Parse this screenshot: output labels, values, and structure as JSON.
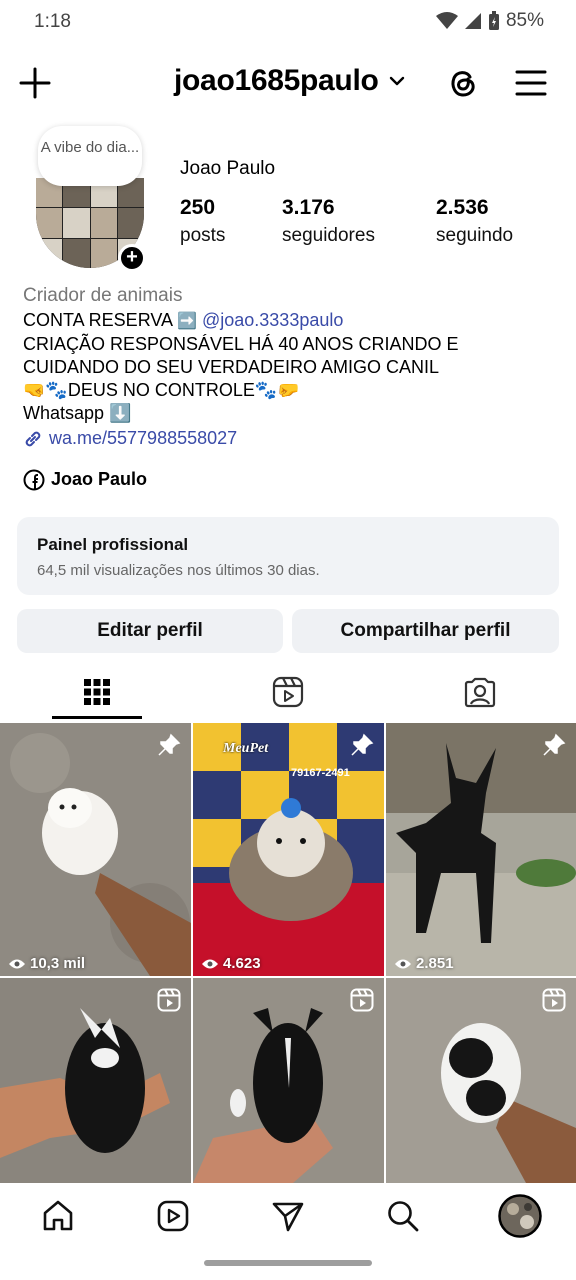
{
  "status_bar": {
    "time": "1:18",
    "battery": "85%"
  },
  "header": {
    "username": "joao1685paulo"
  },
  "profile": {
    "note": "A vibe do dia...",
    "full_name": "Joao Paulo",
    "stats": [
      {
        "value": "250",
        "label": "posts"
      },
      {
        "value": "3.176",
        "label": "seguidores"
      },
      {
        "value": "2.536",
        "label": "seguindo"
      }
    ]
  },
  "bio": {
    "category": "Criador de animais",
    "line1_prefix": "CONTA RESERVA ",
    "line1_emoji": "➡️",
    "line1_mention": "@joao.3333paulo",
    "line2": "CRIAÇÃO RESPONSÁVEL HÁ 40 ANOS CRIANDO E",
    "line3": "CUIDANDO DO SEU VERDADEIRO AMIGO CANIL",
    "line4": "🤜🐾DEUS NO CONTROLE🐾🤛",
    "line5": "Whatsapp ⬇️",
    "link": "wa.me/5577988558027",
    "facebook_name": "Joao Paulo"
  },
  "pro_panel": {
    "title": "Painel profissional",
    "subtitle": "64,5 mil visualizações nos últimos 30 dias."
  },
  "buttons": {
    "edit": "Editar perfil",
    "share": "Compartilhar perfil"
  },
  "posts": [
    {
      "views": "10,3 mil",
      "badge": "pin-icon"
    },
    {
      "views": "4.623",
      "badge": "pin-icon"
    },
    {
      "views": "2.851",
      "badge": "pin-icon"
    },
    {
      "views": "",
      "badge": "reel-icon"
    },
    {
      "views": "",
      "badge": "reel-icon"
    },
    {
      "views": "",
      "badge": "reel-icon"
    }
  ],
  "post4_text": {
    "brand": "MeuPet",
    "phone": "79167-2491"
  },
  "colors": {
    "link": "#3a4ba8",
    "panel_bg": "#f1f3f6",
    "button_bg": "#eff1f4"
  }
}
